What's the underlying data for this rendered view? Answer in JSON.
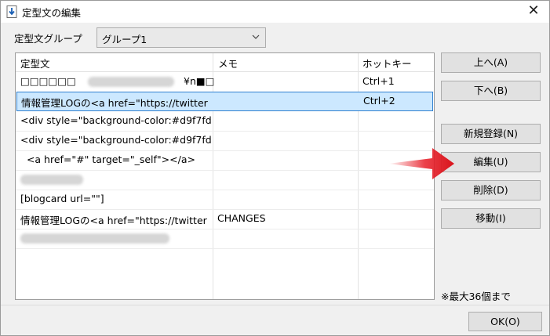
{
  "window": {
    "title": "定型文の編集",
    "close_symbol": "✕"
  },
  "group": {
    "label": "定型文グループ",
    "selected": "グループ1"
  },
  "table": {
    "columns": [
      "定型文",
      "メモ",
      "ホットキー"
    ],
    "rows": [
      {
        "text": "□□□□□□",
        "text_tail": "¥n■□",
        "memo": "",
        "hotkey": "Ctrl+1",
        "selected": false
      },
      {
        "text": "情報管理LOGの<a href=\"https://twitter",
        "memo": "",
        "hotkey": "Ctrl+2",
        "selected": true
      },
      {
        "text": "<div style=\"background-color:#d9f7fd",
        "memo": "",
        "hotkey": "",
        "selected": false
      },
      {
        "text": "<div style=\"background-color:#d9f7fd",
        "memo": "",
        "hotkey": "",
        "selected": false
      },
      {
        "text": "  <a href=\"#\" target=\"_self\"></a>",
        "memo": "",
        "hotkey": "",
        "selected": false
      },
      {
        "text": "",
        "memo": "",
        "hotkey": "",
        "selected": false
      },
      {
        "text": "[blogcard url=\"\"]",
        "memo": "",
        "hotkey": "",
        "selected": false
      },
      {
        "text": "情報管理LOGの<a href=\"https://twitter",
        "memo": "CHANGES",
        "hotkey": "",
        "selected": false
      },
      {
        "text": "",
        "memo": "",
        "hotkey": "",
        "selected": false
      }
    ]
  },
  "buttons": {
    "up": "上へ(A)",
    "down": "下へ(B)",
    "new": "新規登録(N)",
    "edit": "編集(U)",
    "delete": "削除(D)",
    "move": "移動(I)",
    "ok": "OK(O)"
  },
  "note": "※最大36個まで",
  "colors": {
    "selection": "#cce8ff",
    "selection_border": "#2f80d0",
    "arrow": "#e8202a"
  }
}
